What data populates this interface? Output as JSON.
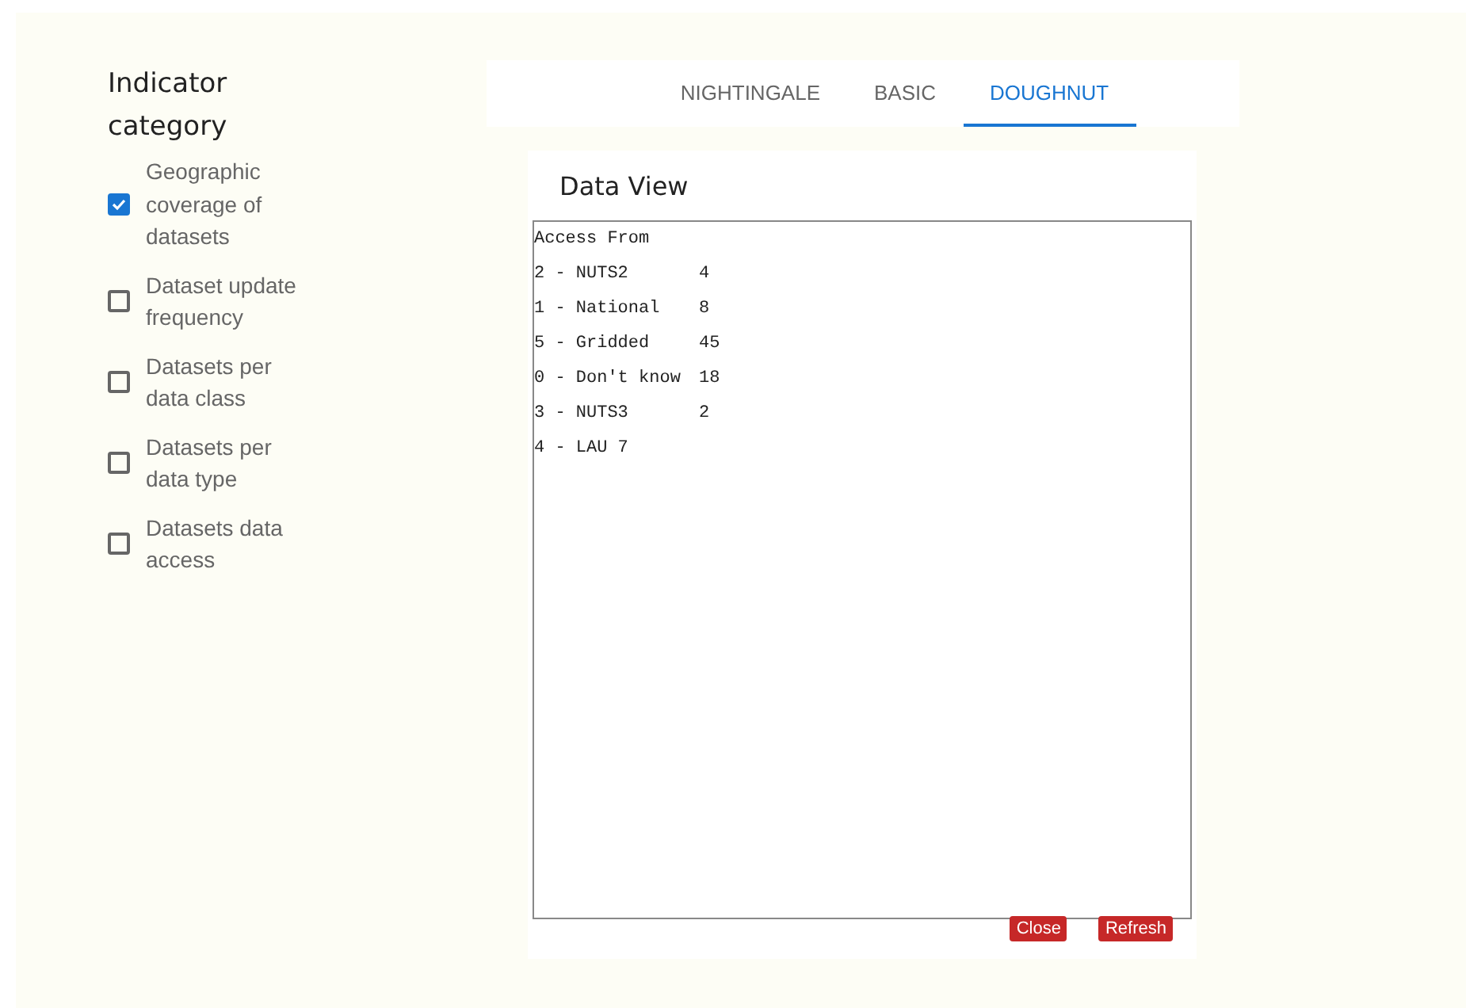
{
  "sidebar": {
    "title": "Indicator category",
    "items": [
      {
        "label": "Geographic coverage of datasets",
        "checked": true
      },
      {
        "label": "Dataset update frequency",
        "checked": false
      },
      {
        "label": "Datasets per data class",
        "checked": false
      },
      {
        "label": "Datasets per data type",
        "checked": false
      },
      {
        "label": "Datasets data access",
        "checked": false
      }
    ]
  },
  "tabs": [
    {
      "label": "NIGHTINGALE",
      "selected": false
    },
    {
      "label": "BASIC",
      "selected": false
    },
    {
      "label": "DOUGHNUT",
      "selected": true
    }
  ],
  "data_view": {
    "title": "Data View",
    "heading": "Access From",
    "rows": [
      {
        "label": "2 - NUTS2",
        "value": "4"
      },
      {
        "label": "1 - National",
        "value": "8"
      },
      {
        "label": "5 - Gridded",
        "value": "45"
      },
      {
        "label": "0 - Don't know",
        "value": "18"
      },
      {
        "label": "3 - NUTS3",
        "value": "2"
      },
      {
        "label": "4 - LAU 7"
      }
    ],
    "buttons": [
      "Close",
      "Refresh"
    ]
  }
}
